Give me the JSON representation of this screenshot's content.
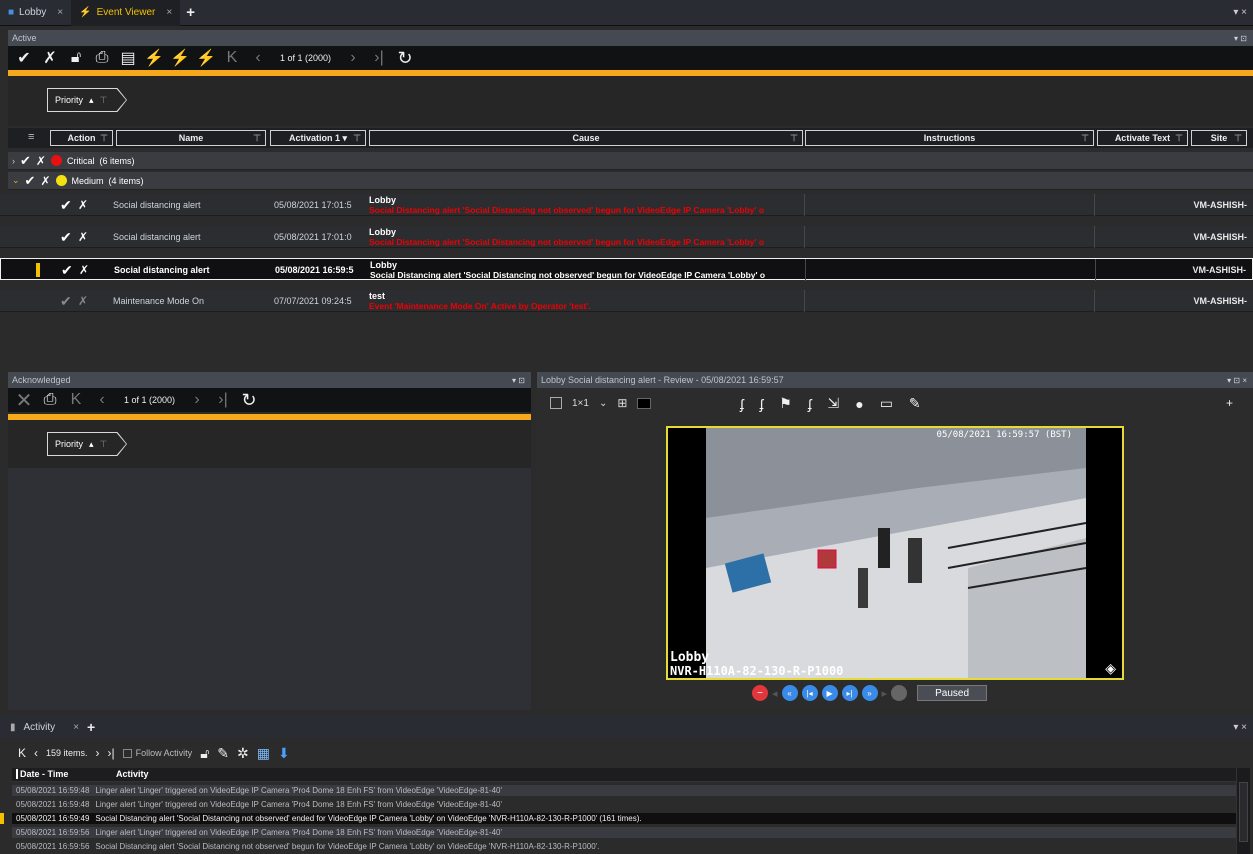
{
  "tabs": [
    {
      "label": "Lobby",
      "active": false,
      "icon": "monitor-icon"
    },
    {
      "label": "Event Viewer",
      "active": true,
      "icon": "lightning-icon"
    }
  ],
  "active_panel": {
    "title": "Active",
    "pager": "1 of 1 (2000)",
    "filter_chip": "Priority",
    "columns": [
      "Action",
      "Name",
      "Activation 1",
      "Cause",
      "Instructions",
      "Activate Text",
      "Site"
    ],
    "groups": [
      {
        "label": "Critical",
        "count": "(6 items)",
        "color": "#e81010",
        "expanded": false
      },
      {
        "label": "Medium",
        "count": "(4 items)",
        "color": "#f2e010",
        "expanded": true
      }
    ],
    "rows": [
      {
        "name": "Social distancing alert",
        "activation": "05/08/2021 17:01:5",
        "cause_title": "Lobby",
        "cause": "Social Distancing alert 'Social Distancing not observed' begun for VideoEdge IP Camera 'Lobby' o",
        "site": "VM-ASHISH-",
        "selected": false
      },
      {
        "name": "Social distancing alert",
        "activation": "05/08/2021 17:01:0",
        "cause_title": "Lobby",
        "cause": "Social Distancing alert 'Social Distancing not observed' begun for VideoEdge IP Camera 'Lobby' o",
        "site": "VM-ASHISH-",
        "selected": false
      },
      {
        "name": "Social distancing alert",
        "activation": "05/08/2021 16:59:5",
        "cause_title": "Lobby",
        "cause": "Social Distancing alert 'Social Distancing not observed' begun for VideoEdge IP Camera 'Lobby' o",
        "site": "VM-ASHISH-",
        "selected": true
      },
      {
        "name": "Maintenance Mode On",
        "activation": "07/07/2021 09:24:5",
        "cause_title": "test",
        "cause": "Event 'Maintenance Mode On' Active by Operator 'test'.",
        "site": "VM-ASHISH-",
        "selected": false
      }
    ]
  },
  "acknowledged_panel": {
    "title": "Acknowledged",
    "pager": "1 of 1 (2000)",
    "filter_chip": "Priority"
  },
  "review_panel": {
    "title": "Lobby Social distancing alert - Review - 05/08/2021 16:59:57",
    "layout_label": "1×1",
    "timestamp": "05/08/2021 16:59:57 (BST)",
    "camera_name": "Lobby",
    "recorder_name": "NVR-H110A-82-130-R-P1000",
    "playback_state": "Paused"
  },
  "activity_panel": {
    "tab_label": "Activity",
    "items_count": "159 items.",
    "follow_label": "Follow Activity",
    "columns": [
      "Date - Time",
      "Activity"
    ],
    "rows": [
      {
        "time": "05/08/2021 16:59:48",
        "text": "Linger alert 'Linger' triggered on VideoEdge IP Camera 'Pro4 Dome 18 Enh FS' from VideoEdge 'VideoEdge-81-40'"
      },
      {
        "time": "05/08/2021 16:59:48",
        "text": "Linger alert 'Linger' triggered on VideoEdge IP Camera 'Pro4 Dome 18 Enh FS' from VideoEdge 'VideoEdge-81-40'"
      },
      {
        "time": "05/08/2021 16:59:49",
        "text": "Social Distancing alert 'Social Distancing not observed' ended for VideoEdge IP Camera 'Lobby' on VideoEdge 'NVR-H110A-82-130-R-P1000' (161 times)."
      },
      {
        "time": "05/08/2021 16:59:56",
        "text": "Linger alert 'Linger' triggered on VideoEdge IP Camera 'Pro4 Dome 18 Enh FS' from VideoEdge 'VideoEdge-81-40'"
      },
      {
        "time": "05/08/2021 16:59:56",
        "text": "Social Distancing alert 'Social Distancing not observed' begun for VideoEdge IP Camera 'Lobby' on VideoEdge 'NVR-H110A-82-130-R-P1000'."
      }
    ]
  },
  "colors": {
    "accent": "#f5a81c",
    "tab_active": "#f2c200",
    "alert_red": "#e00000",
    "video_border": "#e4dc35"
  }
}
